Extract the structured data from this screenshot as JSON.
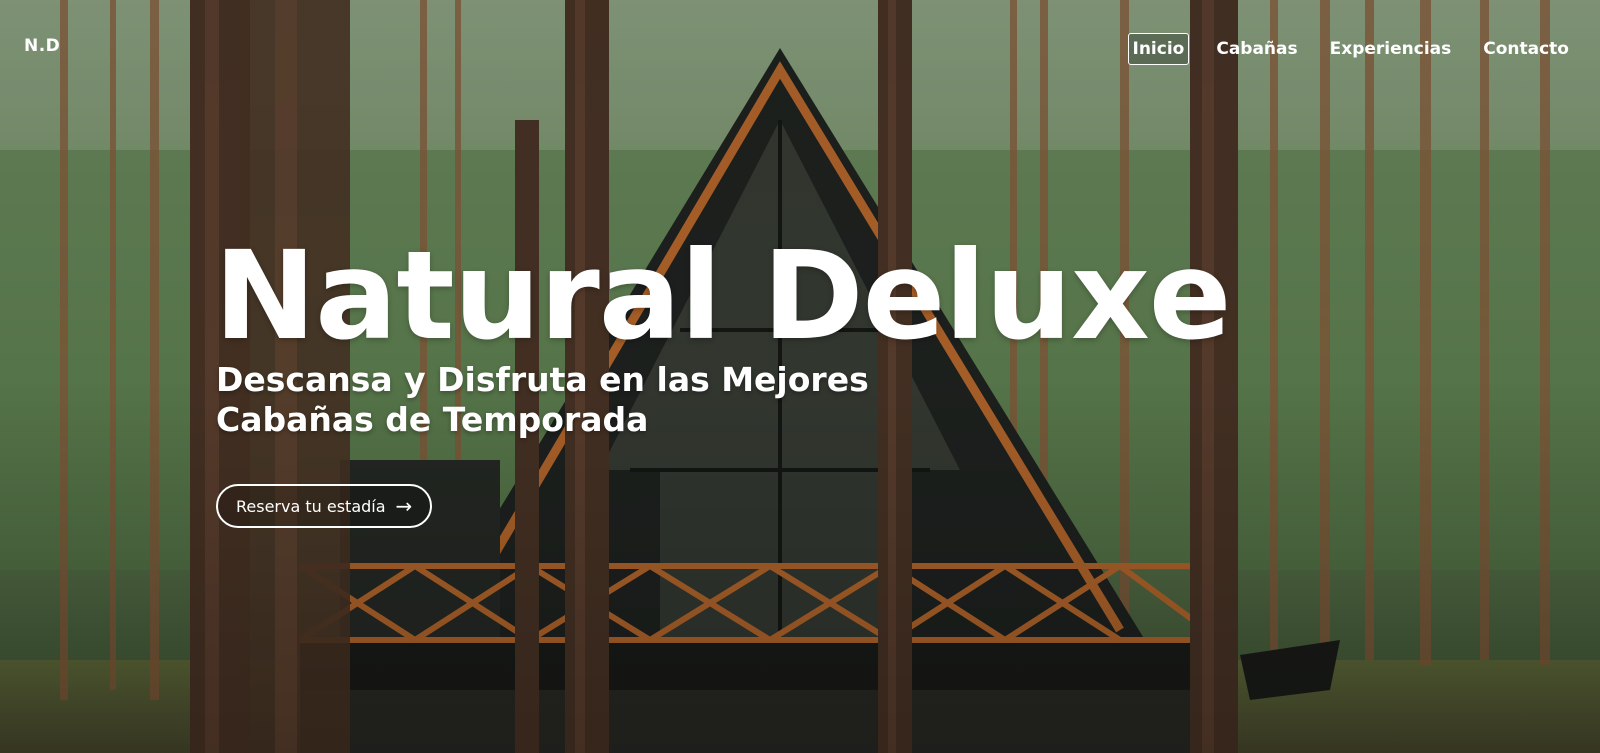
{
  "brand": {
    "logo": "N.D"
  },
  "nav": {
    "items": [
      {
        "label": "Inicio",
        "active": true
      },
      {
        "label": "Cabañas",
        "active": false
      },
      {
        "label": "Experiencias",
        "active": false
      },
      {
        "label": "Contacto",
        "active": false
      }
    ]
  },
  "hero": {
    "title": "Natural Deluxe",
    "subtitle": "Descansa y Disfruta en las Mejores Cabañas de Temporada",
    "cta_label": "Reserva tu estadía",
    "cta_icon": "arrow-right-icon",
    "background": "forest-a-frame-cabin-photo"
  },
  "colors": {
    "text": "#ffffff",
    "cabin_dark": "#1f2320",
    "wood_accent": "#b8682c",
    "forest_green": "#4f6a45"
  }
}
